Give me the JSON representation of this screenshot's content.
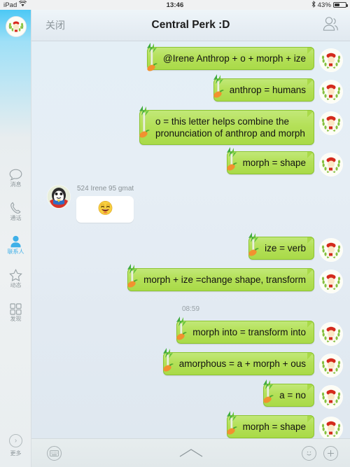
{
  "statusbar": {
    "carrier": "iPad",
    "wifi_icon": "wifi-icon",
    "time": "13:46",
    "bluetooth_icon": "bluetooth-icon",
    "battery_percent": "43%",
    "battery_level": 43
  },
  "sidebar": {
    "avatar_name": "user-avatar",
    "items": [
      {
        "label": "消息",
        "icon": "chat-bubble-icon",
        "active": false
      },
      {
        "label": "通话",
        "icon": "phone-icon",
        "active": false
      },
      {
        "label": "联系人",
        "icon": "person-icon",
        "active": true
      },
      {
        "label": "动态",
        "icon": "star-icon",
        "active": false
      },
      {
        "label": "发现",
        "icon": "grid-icon",
        "active": false
      }
    ],
    "more": {
      "label": "更多",
      "icon": "chevron-right-icon"
    }
  },
  "navbar": {
    "close_label": "关闭",
    "title": "Central Perk :D",
    "people_icon": "people-icon"
  },
  "chat": {
    "accent_bubble_color": "#b4e058",
    "bubble_border_color": "#8cc431",
    "background_color": "#e4eff6",
    "messages": [
      {
        "type": "out",
        "text": "@Irene     Anthrop + o + morph + ize"
      },
      {
        "type": "out",
        "text": "anthrop = humans"
      },
      {
        "type": "out",
        "text": "o = this letter helps combine the pronunciation of anthrop and morph"
      },
      {
        "type": "out",
        "text": "morph = shape"
      },
      {
        "type": "in",
        "sender": "524 Irene 95 gmat",
        "sticker": "grinning-emoji"
      },
      {
        "type": "out",
        "text": "ize = verb"
      },
      {
        "type": "out",
        "text": "morph + ize  =change shape, transform"
      },
      {
        "type": "divider",
        "text": "08:59"
      },
      {
        "type": "out",
        "text": "morph into =  transform into"
      },
      {
        "type": "out",
        "text": "amorphous  = a + morph + ous"
      },
      {
        "type": "out",
        "text": "a = no"
      },
      {
        "type": "out",
        "text": "morph = shape"
      }
    ]
  },
  "toolbar": {
    "keyboard_icon": "keyboard-icon",
    "chevron_icon": "chevron-up-icon",
    "emoji_icon": "smiley-icon",
    "plus_icon": "plus-icon"
  }
}
